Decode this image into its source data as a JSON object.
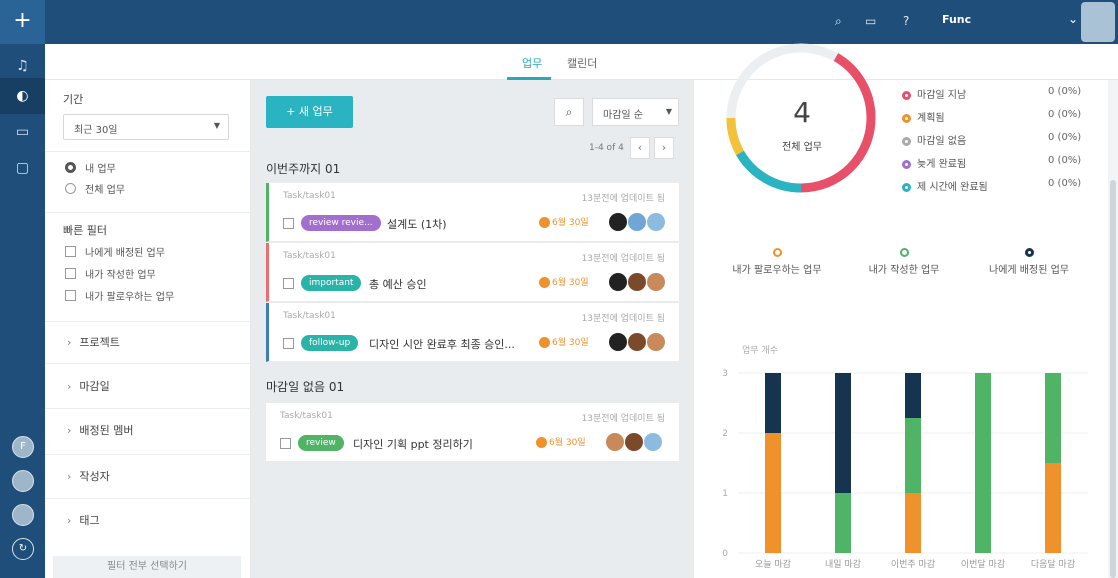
{
  "topbar": {
    "user": "Func"
  },
  "tabs": [
    {
      "label": "업무",
      "active": true
    },
    {
      "label": "캘린더",
      "active": false
    }
  ],
  "filter": {
    "period_label": "기간",
    "period_value": "최근 30일",
    "scope": [
      {
        "label": "내 업무",
        "selected": true
      },
      {
        "label": "전체 업무",
        "selected": false
      }
    ],
    "quick_label": "빠른 필터",
    "quick": [
      "나에게 배정된 업무",
      "내가 작성한 업무",
      "내가 팔로우하는 업무"
    ],
    "sections": [
      "프로젝트",
      "마감일",
      "배정된 멤버",
      "작성자",
      "태그"
    ],
    "select_all": "필터 전부 선택하기"
  },
  "tasks": {
    "new_button": "+ 새 업무",
    "sort_label": "마감일 순",
    "pager_text": "1-4 of 4",
    "groups": [
      {
        "title": "이번주까지 01"
      },
      {
        "title": "마감일 없음 01"
      }
    ],
    "cards": [
      {
        "path": "Task/task01",
        "updated": "13분전에 업데이트 됨",
        "tag": "review revie...",
        "title": "설계도 (1차)",
        "due": "6월 30일"
      },
      {
        "path": "Task/task01",
        "updated": "13분전에 업데이트 됨",
        "tag": "important",
        "title": "총 예산 승인",
        "due": "6월 30일"
      },
      {
        "path": "Task/task01",
        "updated": "13분전에 업데이트 됨",
        "tag": "follow-up",
        "title": "디자인 시안 완료후 최종 승인...",
        "due": "6월 30일"
      },
      {
        "path": "Task/task01",
        "updated": "13분전에 업데이트 됨",
        "tag": "review",
        "title": "디자인 기획 ppt 정리하기",
        "due": "6월 30일"
      }
    ]
  },
  "stats": {
    "total_number": "4",
    "total_label": "전체 업무",
    "legend": [
      {
        "label": "마감일 지남",
        "value": "0 (0%)",
        "color": "#e8506a"
      },
      {
        "label": "계획됨",
        "value": "0 (0%)",
        "color": "#f0922c"
      },
      {
        "label": "마감일 없음",
        "value": "0 (0%)",
        "color": "#aaaaaa"
      },
      {
        "label": "늦게 완료됨",
        "value": "0 (0%)",
        "color": "#a36fce"
      },
      {
        "label": "제 시간에 완료됨",
        "value": "0 (0%)",
        "color": "#2ab3c1"
      }
    ],
    "categories": [
      {
        "label": "내가 팔로우하는 업무",
        "color": "#f0922c"
      },
      {
        "label": "내가 작성한 업무",
        "color": "#4fb466"
      },
      {
        "label": "나에게 배정된 업무",
        "color": "#16344f"
      }
    ]
  },
  "chart_data": {
    "type": "bar",
    "stacked": true,
    "ylabel": "업무 개수",
    "ylim": [
      0,
      3
    ],
    "yticks": [
      "0",
      "1",
      "2",
      "3"
    ],
    "categories": [
      "오늘 마감",
      "내일 마감",
      "이번주 마감",
      "이번달 마감",
      "다음달 마감"
    ],
    "series": [
      {
        "color": "#f0922c",
        "values": [
          2,
          0,
          1,
          0,
          1.5
        ]
      },
      {
        "color": "#4fb466",
        "values": [
          0,
          1,
          1.25,
          3,
          1.5
        ]
      },
      {
        "color": "#16344f",
        "values": [
          1,
          2,
          0.75,
          0,
          0
        ]
      }
    ]
  }
}
